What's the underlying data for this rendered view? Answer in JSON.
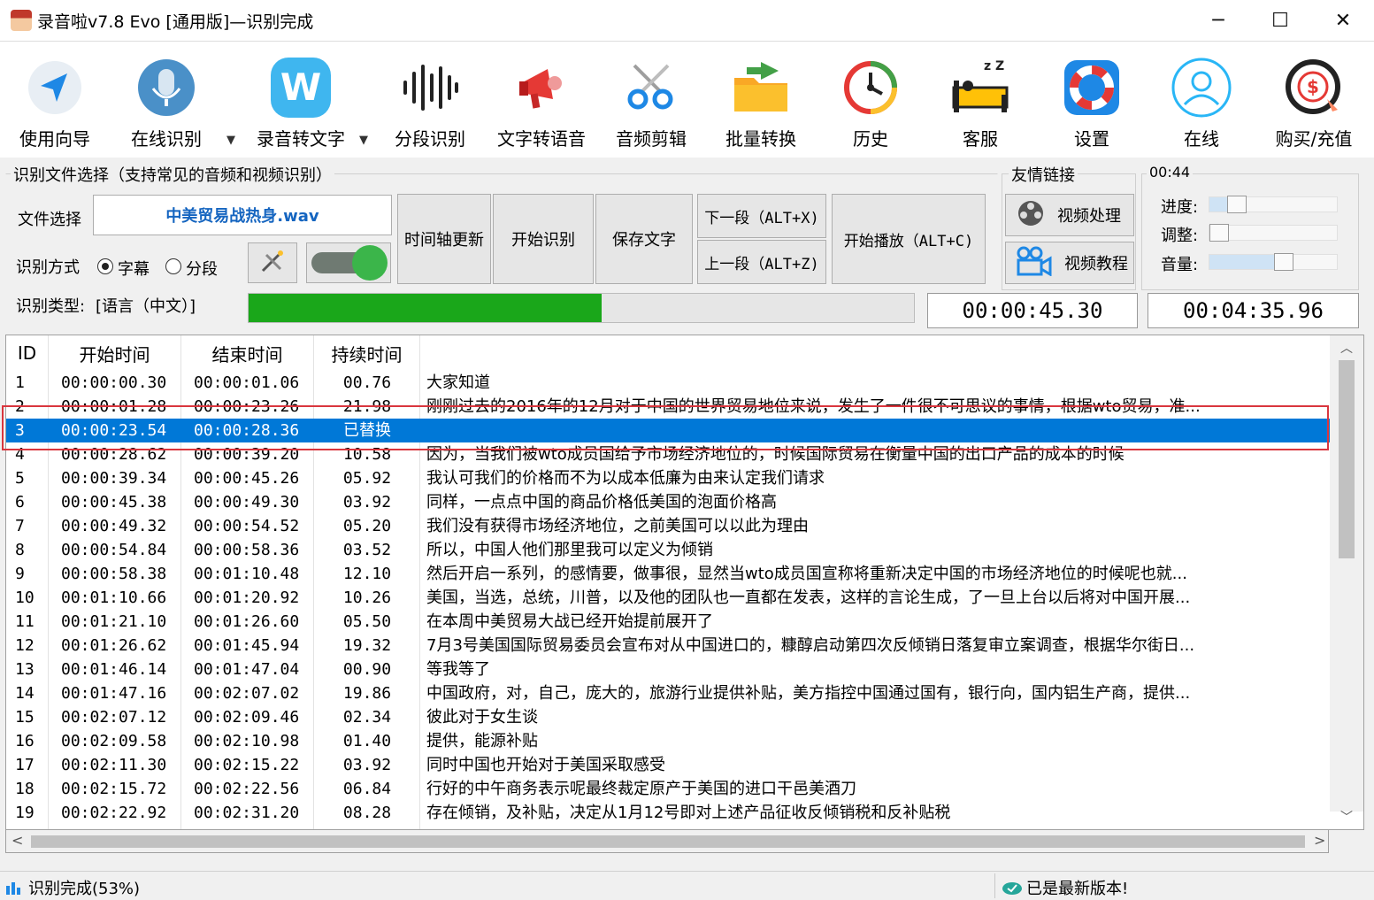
{
  "window": {
    "title": "录音啦v7.8 Evo [通用版]—识别完成",
    "controls": [
      "─",
      "☐",
      "✕"
    ]
  },
  "toolbar": {
    "items": [
      {
        "label": "使用向导",
        "icon": "guide-arrow-icon"
      },
      {
        "label": "在线识别",
        "icon": "microphone-icon"
      },
      {
        "label": "录音转文字",
        "icon": "w-badge-icon"
      },
      {
        "label": "分段识别",
        "icon": "waveform-icon"
      },
      {
        "label": "文字转语音",
        "icon": "megaphone-icon"
      },
      {
        "label": "音频剪辑",
        "icon": "scissors-icon"
      },
      {
        "label": "批量转换",
        "icon": "folder-arrow-icon"
      },
      {
        "label": "历史",
        "icon": "history-clock-icon"
      },
      {
        "label": "客服",
        "icon": "sleeping-bed-icon"
      },
      {
        "label": "设置",
        "icon": "lifebuoy-icon"
      },
      {
        "label": "在线",
        "icon": "user-circle-icon"
      },
      {
        "label": "购买/充值",
        "icon": "dollar-circle-icon"
      }
    ],
    "dropdown_arrow": "▼"
  },
  "recognize_group": {
    "title": "识别文件选择（支持常见的音频和视频识别）",
    "file_label": "文件选择",
    "file_name": "中美贸易战热身.wav",
    "mode_label": "识别方式",
    "mode_options": [
      "字幕",
      "分段"
    ],
    "selected_mode": "字幕",
    "type_label": "识别类型:",
    "type_value": "[语言（中文）]",
    "progress": 0.53,
    "buttons": {
      "timeline_update": "时间轴更新",
      "start_recognize": "开始识别",
      "save_text": "保存文字",
      "next_segment": "下一段（ALT+X)",
      "prev_segment": "上一段（ALT+Z)",
      "start_play": "开始播放（ALT+C)"
    }
  },
  "friend_links": {
    "title": "友情链接",
    "video_process": "视频处理",
    "video_tutorial": "视频教程"
  },
  "player": {
    "elapsed_label": "00:44",
    "progress_label": "进度:",
    "adjust_label": "调整:",
    "volume_label": "音量:",
    "current_time": "00:00:45.30",
    "total_time": "00:04:35.96",
    "progress_value": 0.16,
    "adjust_value": 0.0,
    "volume_value": 0.6
  },
  "table": {
    "columns": [
      "ID",
      "开始时间",
      "结束时间",
      "持续时间",
      ""
    ],
    "rows": [
      {
        "id": "1",
        "start": "00:00:00.30",
        "end": "00:00:01.06",
        "dur": "00.76",
        "text": "大家知道"
      },
      {
        "id": "2",
        "start": "00:00:01.28",
        "end": "00:00:23.26",
        "dur": "21.98",
        "text": "刚刚过去的2016年的12月对于中国的世界贸易地位来说，发生了一件很不可思议的事情，根据wto贸易，准..."
      },
      {
        "id": "3",
        "start": "00:00:23.54",
        "end": "00:00:28.36",
        "dur": "已替换",
        "text": "",
        "selected": true
      },
      {
        "id": "4",
        "start": "00:00:28.62",
        "end": "00:00:39.20",
        "dur": "10.58",
        "text": "因为，当我们被wto成员国给予市场经济地位的，时候国际贸易在衡量中国的出口产品的成本的时候"
      },
      {
        "id": "5",
        "start": "00:00:39.34",
        "end": "00:00:45.26",
        "dur": "05.92",
        "text": "我认可我们的价格而不为以成本低廉为由来认定我们请求"
      },
      {
        "id": "6",
        "start": "00:00:45.38",
        "end": "00:00:49.30",
        "dur": "03.92",
        "text": "同样，一点点中国的商品价格低美国的泡面价格高"
      },
      {
        "id": "7",
        "start": "00:00:49.32",
        "end": "00:00:54.52",
        "dur": "05.20",
        "text": "我们没有获得市场经济地位，之前美国可以以此为理由"
      },
      {
        "id": "8",
        "start": "00:00:54.84",
        "end": "00:00:58.36",
        "dur": "03.52",
        "text": "所以，中国人他们那里我可以定义为倾销"
      },
      {
        "id": "9",
        "start": "00:00:58.38",
        "end": "00:01:10.48",
        "dur": "12.10",
        "text": "然后开启一系列，的感情要，做事很，显然当wto成员国宣称将重新决定中国的市场经济地位的时候呢也就..."
      },
      {
        "id": "10",
        "start": "00:01:10.66",
        "end": "00:01:20.92",
        "dur": "10.26",
        "text": "美国，当选，总统，川普，以及他的团队也一直都在发表，这样的言论生成，了一旦上台以后将对中国开展..."
      },
      {
        "id": "11",
        "start": "00:01:21.10",
        "end": "00:01:26.60",
        "dur": "05.50",
        "text": "在本周中美贸易大战已经开始提前展开了"
      },
      {
        "id": "12",
        "start": "00:01:26.62",
        "end": "00:01:45.94",
        "dur": "19.32",
        "text": "7月3号美国国际贸易委员会宣布对从中国进口的，糠醇启动第四次反倾销日落复审立案调查，根据华尔街日..."
      },
      {
        "id": "13",
        "start": "00:01:46.14",
        "end": "00:01:47.04",
        "dur": "00.90",
        "text": "等我等了"
      },
      {
        "id": "14",
        "start": "00:01:47.16",
        "end": "00:02:07.02",
        "dur": "19.86",
        "text": "中国政府，对，自己，庞大的，旅游行业提供补贴，美方指控中国通过国有，银行向，国内铝生产商，提供..."
      },
      {
        "id": "15",
        "start": "00:02:07.12",
        "end": "00:02:09.46",
        "dur": "02.34",
        "text": "彼此对于女生谈"
      },
      {
        "id": "16",
        "start": "00:02:09.58",
        "end": "00:02:10.98",
        "dur": "01.40",
        "text": "提供，能源补贴"
      },
      {
        "id": "17",
        "start": "00:02:11.30",
        "end": "00:02:15.22",
        "dur": "03.92",
        "text": "同时中国也开始对于美国采取感受"
      },
      {
        "id": "18",
        "start": "00:02:15.72",
        "end": "00:02:22.56",
        "dur": "06.84",
        "text": "行好的中午商务表示呢最终裁定原产于美国的进口干邑美酒刀"
      },
      {
        "id": "19",
        "start": "00:02:22.92",
        "end": "00:02:31.20",
        "dur": "08.28",
        "text": "存在倾销，及补贴，决定从1月12号即对上述产品征收反倾销税和反补贴税"
      }
    ]
  },
  "status": {
    "left": "识别完成(53%)",
    "right": "已是最新版本!"
  },
  "colors": {
    "selection": "#0078d7",
    "progress": "#1aa71a",
    "highlight_border": "#d9363e"
  }
}
